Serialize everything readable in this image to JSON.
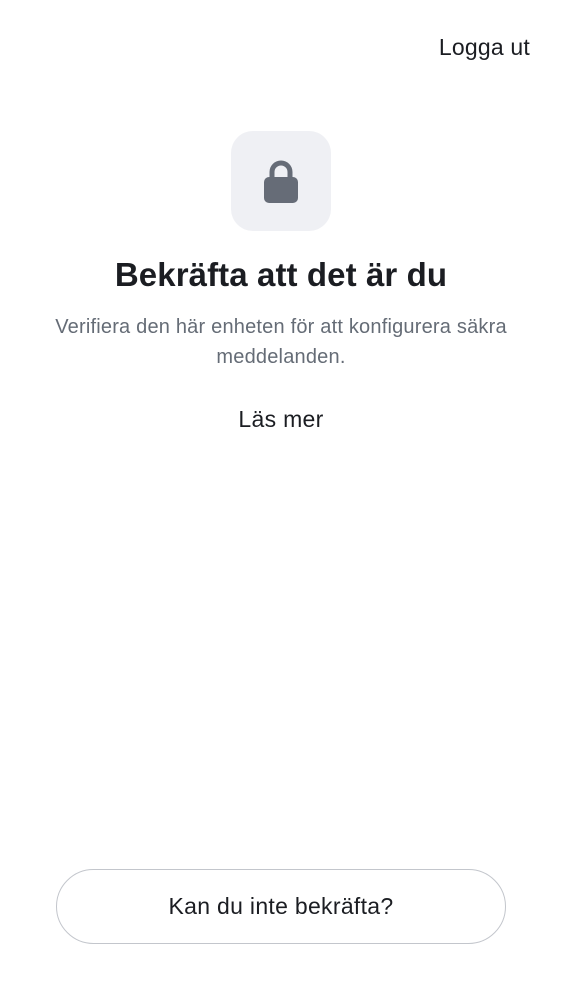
{
  "header": {
    "logout_label": "Logga ut"
  },
  "icon": {
    "name": "lock-icon",
    "tile_color": "#eff0f4",
    "icon_color": "#666c77"
  },
  "main": {
    "title": "Bekräfta att det är du",
    "description": "Verifiera den här enheten för att konfigurera säkra meddelanden.",
    "learn_more_label": "Läs mer"
  },
  "footer": {
    "cant_confirm_label": "Kan du inte bekräfta?"
  }
}
